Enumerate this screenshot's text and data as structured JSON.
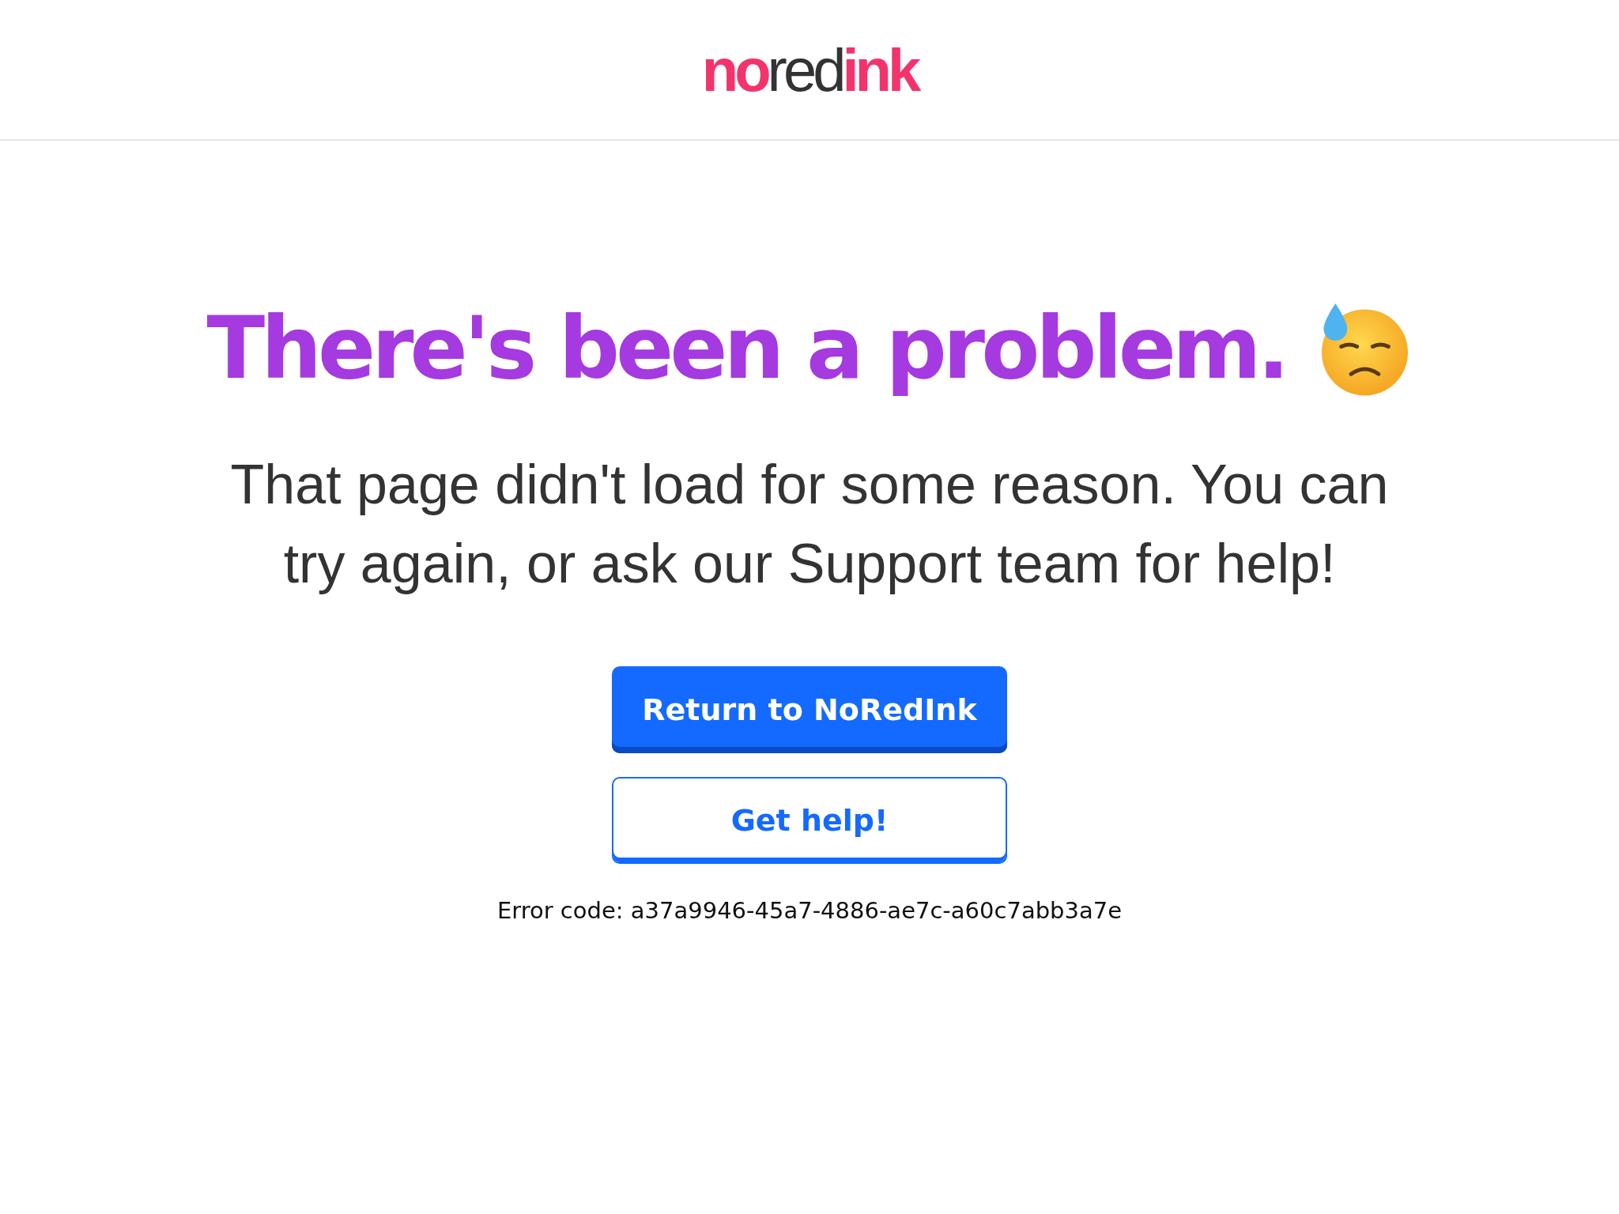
{
  "header": {
    "logo": [
      {
        "text": "no",
        "emphasis": true
      },
      {
        "text": "red",
        "emphasis": false
      },
      {
        "text": "ink",
        "emphasis": true
      }
    ]
  },
  "title": "There's been a problem.",
  "message": "That page didn't load for some reason. You can try again, or ask our Support team for help!",
  "buttons": [
    {
      "label": "Return to NoRedInk",
      "kind": "primary"
    },
    {
      "label": "Get help!",
      "kind": "secondary"
    }
  ],
  "error_code": "Error code: a37a9946-45a7-4886-ae7c-a60c7abb3a7e"
}
